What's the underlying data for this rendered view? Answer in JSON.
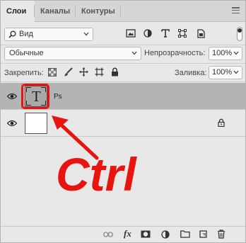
{
  "tabs": [
    {
      "label": "Слои"
    },
    {
      "label": "Каналы"
    },
    {
      "label": "Контуры"
    }
  ],
  "filter": {
    "label": "Вид"
  },
  "blend": {
    "mode": "Обычные",
    "opacity_label": "Непрозрачность:",
    "opacity_value": "100%"
  },
  "lock": {
    "label": "Закрепить:",
    "fill_label": "Заливка:",
    "fill_value": "100%"
  },
  "layers": [
    {
      "name": "Ps",
      "thumb_text": "T",
      "selected": true
    },
    {
      "name": "",
      "thumb_text": "",
      "selected": false
    }
  ],
  "annotation": {
    "text": "Ctrl",
    "color": "#e8140f"
  },
  "colors": {
    "highlight": "#e8140f",
    "selected_row": "#b4b4b4"
  }
}
